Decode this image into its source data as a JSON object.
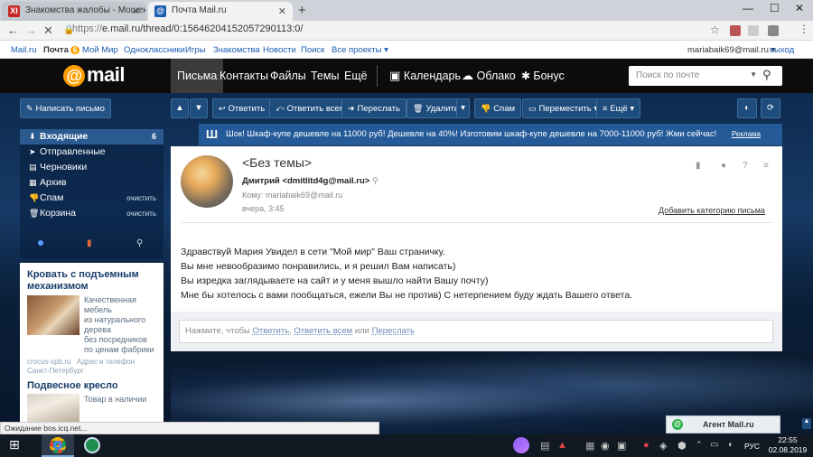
{
  "browser": {
    "tabs": [
      {
        "title": "Знакомства жалобы - Мошенн",
        "icon": "xi-icon"
      },
      {
        "title": "Почта Mail.ru",
        "icon": "mailru-icon"
      }
    ],
    "url_scheme": "https://",
    "url_rest": "e.mail.ru/thread/0:15646204152057290113:0/",
    "status": "Ожидание bos.icq.net..."
  },
  "portal": {
    "links": [
      "Mail.ru",
      "Почта",
      "Мой Мир",
      "Одноклассники",
      "Игры",
      "Знакомства",
      "Новости",
      "Поиск",
      "Все проекты ▾"
    ],
    "mail_badge": "6",
    "user": "mariabaik69@mail.ru ▾",
    "logout": "выход"
  },
  "header": {
    "logo": "mail",
    "nav": [
      "Письма",
      "Контакты",
      "Файлы",
      "Темы",
      "Ещё"
    ],
    "services": [
      "Календарь",
      "Облако",
      "Бонус"
    ],
    "search_placeholder": "Поиск по почте"
  },
  "toolbar": {
    "compose": "Написать письмо",
    "reply": "Ответить",
    "reply_all": "Ответить всем",
    "forward": "Переслать",
    "delete": "Удалить",
    "spam": "Спам",
    "move": "Переместить ▾",
    "more": "Ещё ▾"
  },
  "folders": [
    {
      "name": "Входящие",
      "count": "6",
      "action": ""
    },
    {
      "name": "Отправленные",
      "count": "",
      "action": ""
    },
    {
      "name": "Черновики",
      "count": "",
      "action": ""
    },
    {
      "name": "Архив",
      "count": "",
      "action": ""
    },
    {
      "name": "Спам",
      "count": "",
      "action": "очистить"
    },
    {
      "name": "Корзина",
      "count": "",
      "action": "очистить"
    }
  ],
  "ads": [
    {
      "title": "Кровать с подъемным механизмом",
      "text": [
        "Качественная",
        "мебель",
        "из натурального",
        "дерева",
        "без посредников",
        "по ценам фабрики"
      ],
      "source": "crocus-spb.ru",
      "address": "Адрес и телефон",
      "city": "Санкт-Петербург"
    },
    {
      "title": "Подвесное кресло",
      "text": [
        "Товар в наличии"
      ]
    }
  ],
  "banner": {
    "text": "Шок! Шкаф-купе дешевле на 11000 руб!   Дешевле на 40%! Изготовим шкаф-купе дешевле на 7000-11000 руб! Жми сейчас!",
    "label": "Реклама"
  },
  "message": {
    "subject": "<Без темы>",
    "sender": "Дмитрий <dmitlitd4g@mail.ru>",
    "to": "Кому: mariabaik69@mail.ru",
    "date": "вчера, 3:45",
    "add_category": "Добавить категорию письма",
    "body": [
      "Здравствуй Мария Увидел в сети \"Мой мир\" Ваш страничку.",
      "Вы мне невообразимо понравились, и я решил Вам написать)",
      "Вы изредка заглядываете на сайт и у меня вышло найти Вашу почту)",
      "Мне бы хотелось с вами пообщаться, ежели Вы не против) С нетерпением буду ждать Вашего ответа."
    ],
    "reply_prefix": "Нажмите, чтобы",
    "reply_link1": "Ответить",
    "reply_sep1": ",",
    "reply_link2": "Ответить всем",
    "reply_sep2": "или",
    "reply_link3": "Переслать"
  },
  "agent": "Агент Mail.ru",
  "taskbar": {
    "lang": "РУС",
    "time": "22:55",
    "date": "02.08.2019"
  },
  "colors": {
    "accent": "#ff9e00",
    "toolbar_button": "#1e4d7d",
    "banner": "#245a98",
    "active_folder": "#2a5a90"
  }
}
